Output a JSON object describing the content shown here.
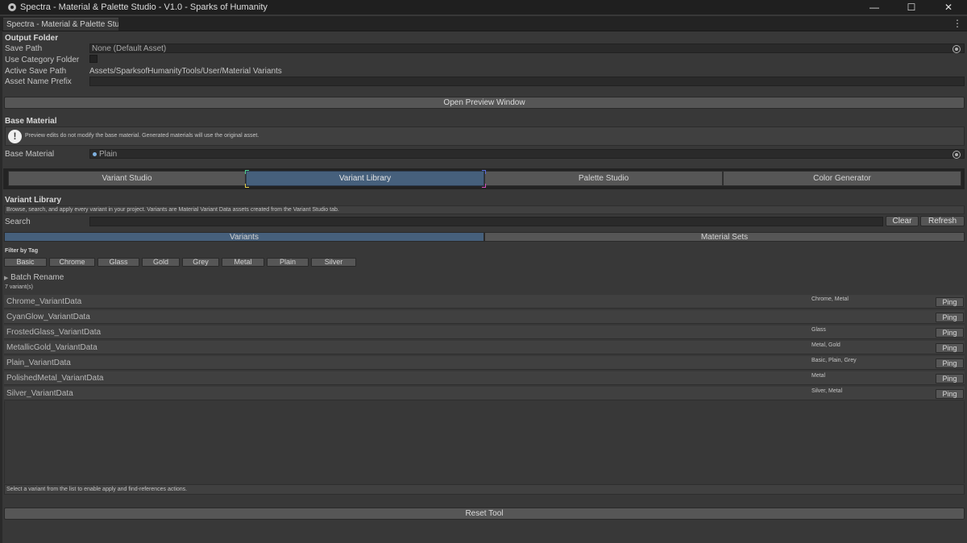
{
  "window": {
    "title": "Spectra - Material & Palette Studio -  V1.0 - Sparks of Humanity",
    "controls": {
      "minimize": "—",
      "maximize": "☐",
      "close": "✕"
    }
  },
  "tab": {
    "label": "Spectra - Material & Palette Studi...",
    "menu": "⋮"
  },
  "output_folder": {
    "header": "Output Folder",
    "save_path_label": "Save Path",
    "save_path_value": "None (Default Asset)",
    "use_category_label": "Use Category Folder",
    "use_category_checked": false,
    "active_save_path_label": "Active Save Path",
    "active_save_path_value": "Assets/SparksofHumanityTools/User/Material Variants",
    "asset_prefix_label": "Asset Name Prefix",
    "asset_prefix_value": ""
  },
  "open_preview_button": "Open Preview Window",
  "base_material": {
    "header": "Base Material",
    "help_icon": "!",
    "help_text": "Preview edits do not modify the base material. Generated materials will use the original asset.",
    "label": "Base Material",
    "value": "Plain"
  },
  "main_tabs": [
    {
      "label": "Variant Studio",
      "active": false
    },
    {
      "label": "Variant Library",
      "active": true
    },
    {
      "label": "Palette Studio",
      "active": false
    },
    {
      "label": "Color Generator",
      "active": false
    }
  ],
  "library": {
    "header": "Variant Library",
    "description": "Browse, search, and apply every variant in your project. Variants are Material Variant Data assets created from the Variant Studio tab.",
    "search_label": "Search",
    "search_value": "",
    "clear_button": "Clear",
    "refresh_button": "Refresh",
    "segments": [
      {
        "label": "Variants",
        "active": true
      },
      {
        "label": "Material Sets",
        "active": false
      }
    ],
    "filter_header": "Filter by Tag",
    "tags": [
      "Basic",
      "Chrome",
      "Glass",
      "Gold",
      "Grey",
      "Metal",
      "Plain",
      "Silver"
    ],
    "batch_rename": "Batch Rename",
    "count_text": "7 variant(s)",
    "ping_label": "Ping",
    "variants": [
      {
        "name": "Chrome_VariantData",
        "tags": "Chrome, Metal"
      },
      {
        "name": "CyanGlow_VariantData",
        "tags": ""
      },
      {
        "name": "FrostedGlass_VariantData",
        "tags": "Glass"
      },
      {
        "name": "MetallicGold_VariantData",
        "tags": "Metal, Gold"
      },
      {
        "name": "Plain_VariantData",
        "tags": "Basic, Plain, Grey"
      },
      {
        "name": "PolishedMetal_VariantData",
        "tags": "Metal"
      },
      {
        "name": "Silver_VariantData",
        "tags": "Silver, Metal"
      }
    ],
    "status_text": "Select a variant from the list to enable apply and find-references actions."
  },
  "reset_button": "Reset Tool",
  "colors": {
    "accent": "#46607c",
    "background": "#383838",
    "titlebar": "#1f1f1f"
  }
}
